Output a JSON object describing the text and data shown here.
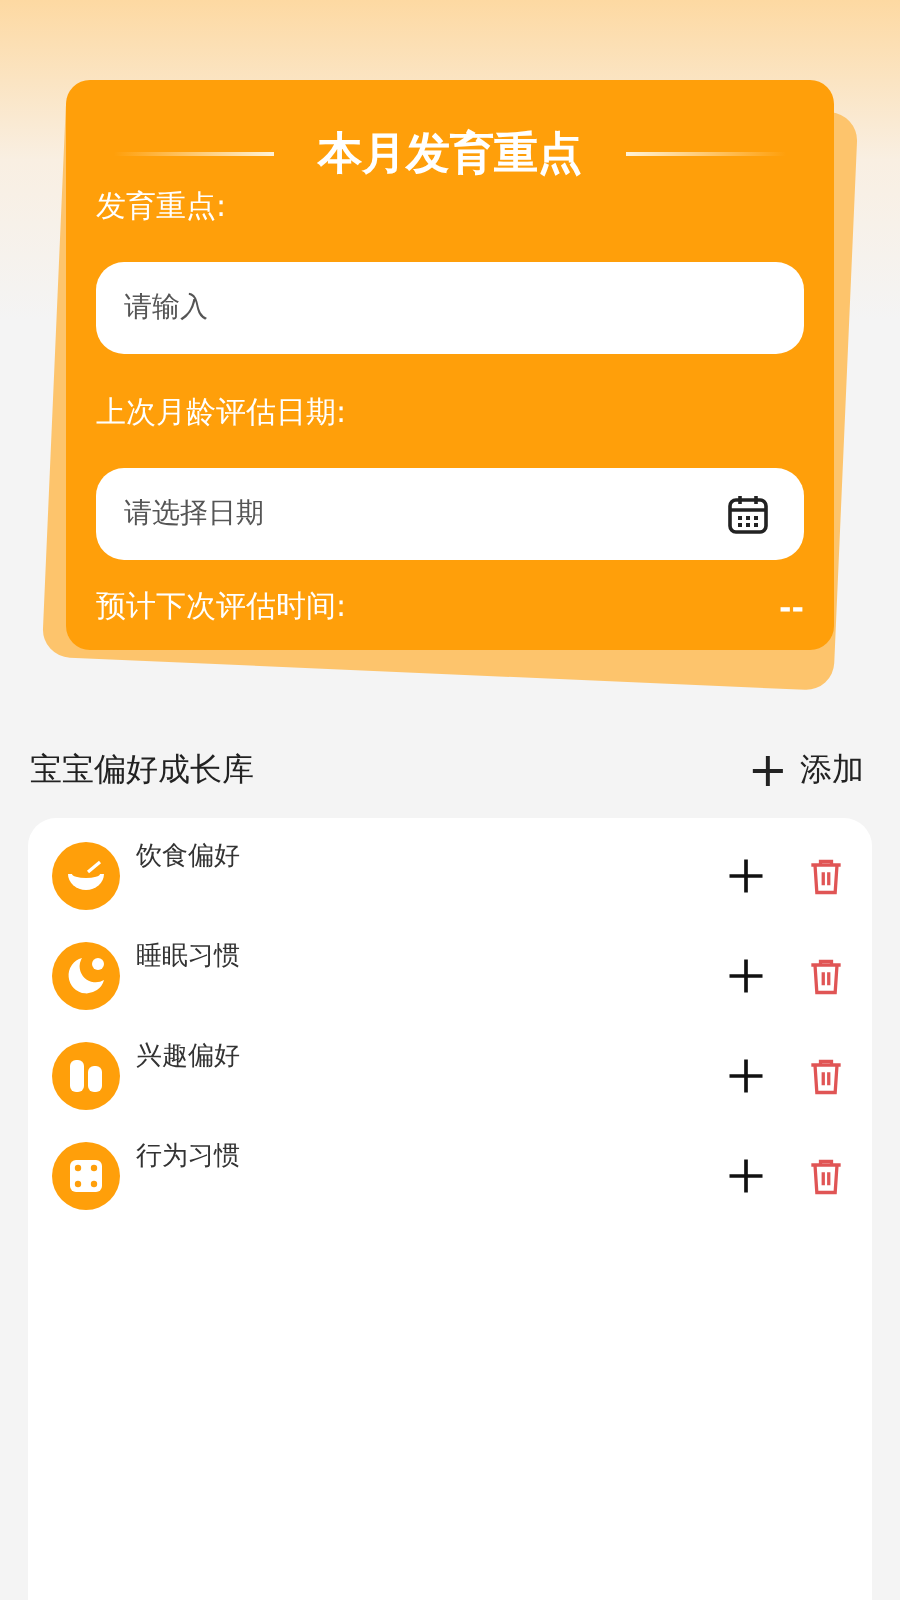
{
  "focus_card": {
    "title": "本月发育重点",
    "focus_label": "发育重点:",
    "focus_field": {
      "placeholder": "请输入"
    },
    "date_label": "上次月龄评估日期:",
    "date_field": {
      "placeholder": "请选择日期"
    },
    "next_label": "预计下次评估时间:",
    "next_value": "--"
  },
  "library": {
    "title": "宝宝偏好成长库",
    "add_icon": "+",
    "add_label": "添加",
    "items": [
      {
        "kind": "bowl",
        "label": "饮食偏好"
      },
      {
        "kind": "moon",
        "label": "睡眠习惯"
      },
      {
        "kind": "toy",
        "label": "兴趣偏好"
      },
      {
        "kind": "dice",
        "label": "行为习惯"
      }
    ]
  }
}
